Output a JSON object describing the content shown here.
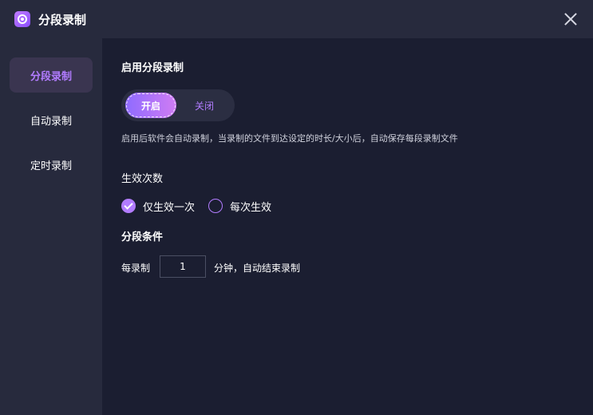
{
  "window": {
    "title": "分段录制",
    "close_icon": "close-icon"
  },
  "sidebar": {
    "items": [
      {
        "label": "分段录制",
        "active": true
      },
      {
        "label": "自动录制",
        "active": false
      },
      {
        "label": "定时录制",
        "active": false
      }
    ]
  },
  "main": {
    "enable_label": "启用分段录制",
    "toggle": {
      "on_label": "开启",
      "off_label": "关闭",
      "selected": "开启"
    },
    "enable_desc": "启用后软件会自动录制，当录制的文件到达设定的时长/大小后，自动保存每段录制文件",
    "effect_label": "生效次数",
    "effect_options": [
      {
        "label": "仅生效一次",
        "checked": true
      },
      {
        "label": "每次生效",
        "checked": false
      }
    ],
    "condition_label": "分段条件",
    "condition_prefix": "每录制",
    "condition_value": "1",
    "condition_suffix": "分钟，自动结束录制"
  },
  "colors": {
    "accent": "#b27cff",
    "background": "#1b1e31",
    "panel": "#272a3d"
  }
}
